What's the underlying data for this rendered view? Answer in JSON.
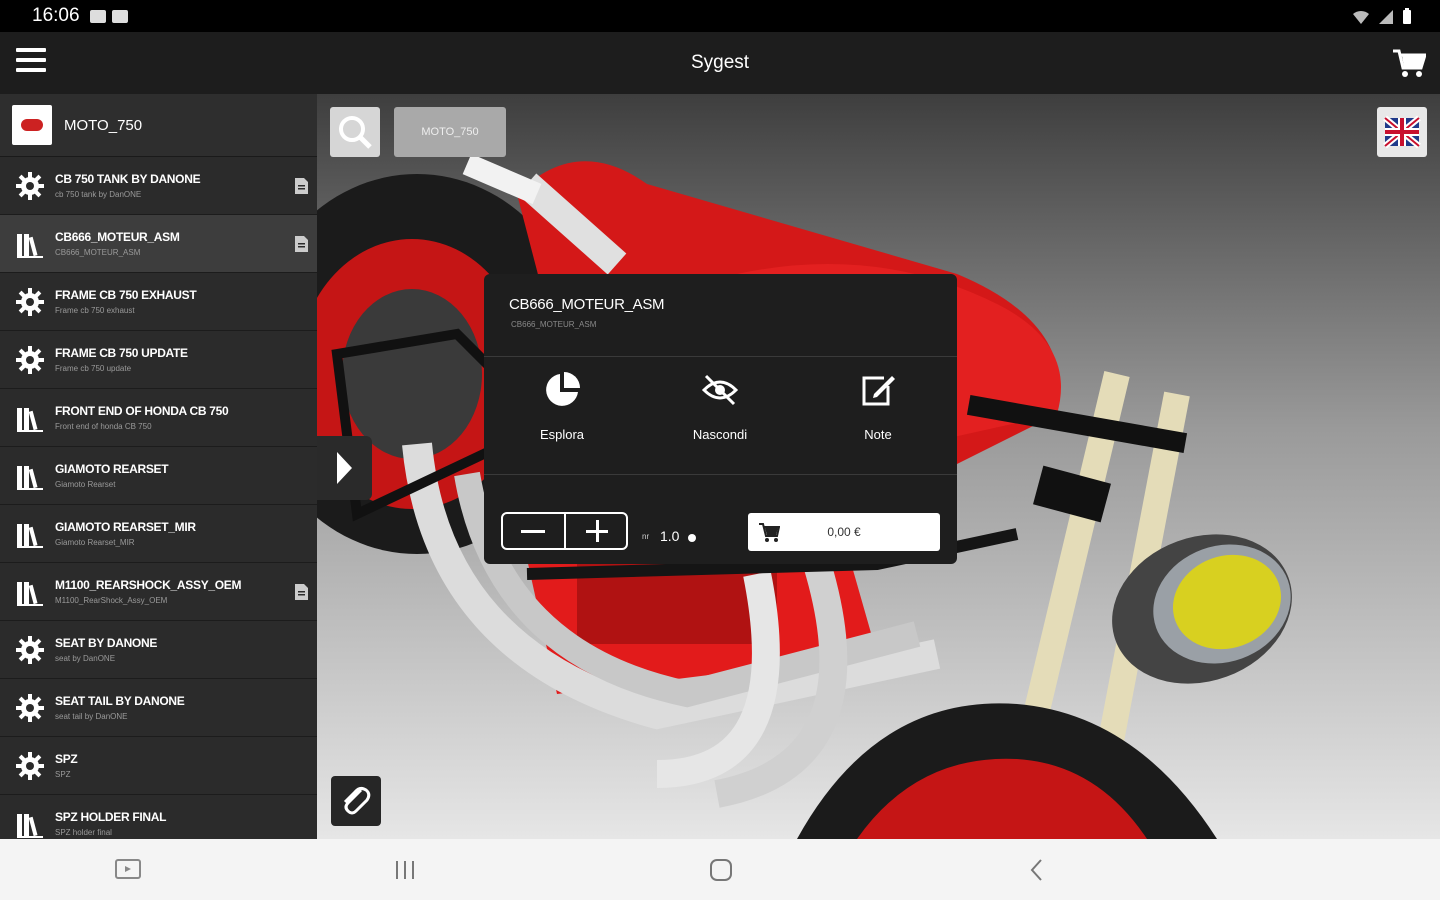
{
  "status_bar": {
    "time": "16:06"
  },
  "app_bar": {
    "title": "Sygest"
  },
  "sidebar": {
    "header": {
      "name": "MOTO_750"
    },
    "items": [
      {
        "title": "CB 750 TANK BY DANONE",
        "subtitle": "cb 750 tank by DanONE",
        "icon": "gear-icon",
        "has_doc": true,
        "selected": false
      },
      {
        "title": "CB666_MOTEUR_ASM",
        "subtitle": "CB666_MOTEUR_ASM",
        "icon": "library-icon",
        "has_doc": true,
        "selected": true
      },
      {
        "title": "FRAME CB 750 EXHAUST",
        "subtitle": "Frame cb 750 exhaust",
        "icon": "gear-icon",
        "has_doc": false,
        "selected": false
      },
      {
        "title": "FRAME CB 750 UPDATE",
        "subtitle": "Frame cb 750 update",
        "icon": "gear-icon",
        "has_doc": false,
        "selected": false
      },
      {
        "title": "FRONT END OF HONDA CB 750",
        "subtitle": "Front end of honda CB 750",
        "icon": "library-icon",
        "has_doc": false,
        "selected": false
      },
      {
        "title": "GIAMOTO REARSET",
        "subtitle": "Giamoto Rearset",
        "icon": "library-icon",
        "has_doc": false,
        "selected": false
      },
      {
        "title": "GIAMOTO REARSET_MIR",
        "subtitle": "Giamoto Rearset_MIR",
        "icon": "library-icon",
        "has_doc": false,
        "selected": false
      },
      {
        "title": "M1100_REARSHOCK_ASSY_OEM",
        "subtitle": "M1100_RearShock_Assy_OEM",
        "icon": "library-icon",
        "has_doc": true,
        "selected": false
      },
      {
        "title": "SEAT BY DANONE",
        "subtitle": "seat by DanONE",
        "icon": "gear-icon",
        "has_doc": false,
        "selected": false
      },
      {
        "title": "SEAT TAIL BY DANONE",
        "subtitle": "seat tail by DanONE",
        "icon": "gear-icon",
        "has_doc": false,
        "selected": false
      },
      {
        "title": "SPZ",
        "subtitle": "SPZ",
        "icon": "gear-icon",
        "has_doc": false,
        "selected": false
      },
      {
        "title": "SPZ HOLDER FINAL",
        "subtitle": "SPZ holder final",
        "icon": "library-icon",
        "has_doc": false,
        "selected": false
      }
    ]
  },
  "viewer": {
    "breadcrumb": "MOTO_750"
  },
  "popup": {
    "title": "CB666_MOTEUR_ASM",
    "subtitle": "CB666_MOTEUR_ASM",
    "actions": [
      {
        "label": "Esplora",
        "icon": "pie-chart-icon"
      },
      {
        "label": "Nascondi",
        "icon": "eye-off-icon"
      },
      {
        "label": "Note",
        "icon": "edit-note-icon"
      }
    ],
    "quantity_unit": "nr",
    "quantity_value": "1.0",
    "price": "0,00 €"
  },
  "colors": {
    "accent_red": "#e21b1b",
    "sidebar_bg": "#2b2b2b",
    "popup_bg": "#1e1e1e"
  }
}
